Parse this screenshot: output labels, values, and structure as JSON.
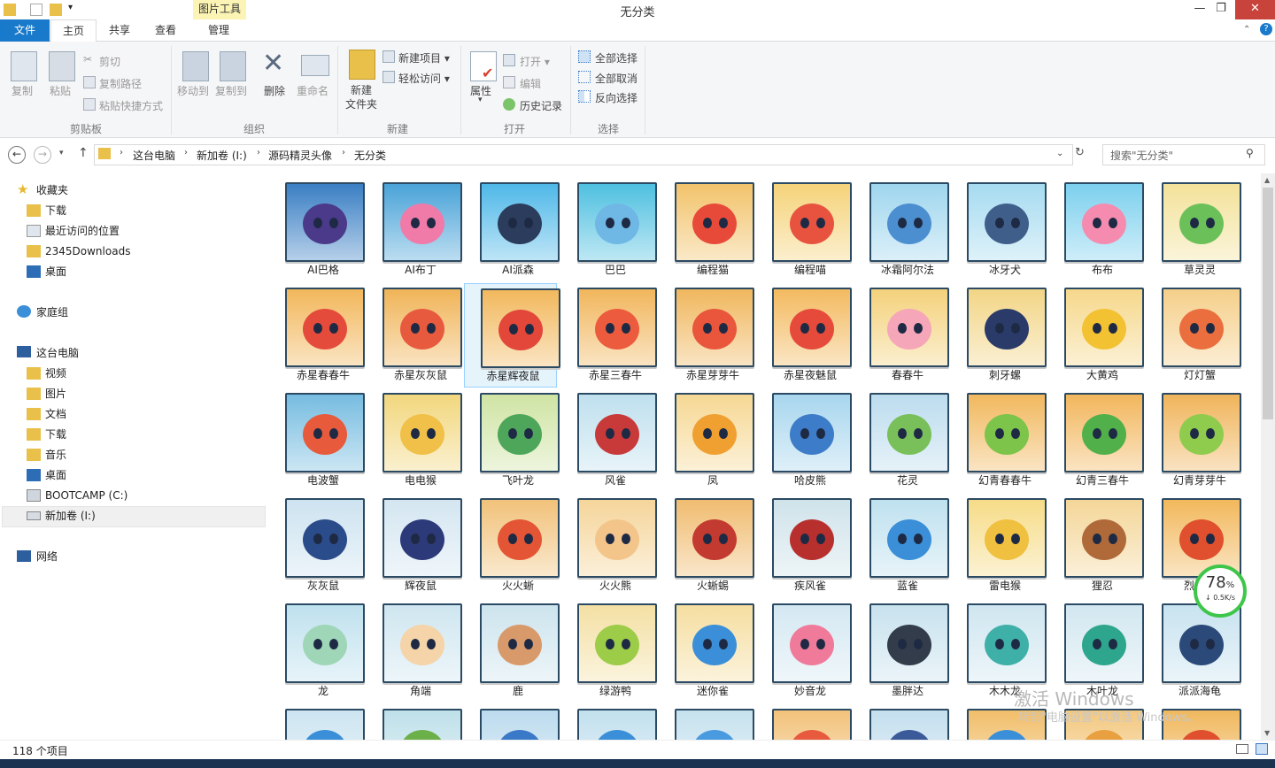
{
  "window": {
    "title": "无分类",
    "context_tab": "图片工具",
    "controls": {
      "minimize": "—",
      "maximize": "❐",
      "close": "✕"
    }
  },
  "tabs": [
    {
      "label": "文件"
    },
    {
      "label": "主页"
    },
    {
      "label": "共享"
    },
    {
      "label": "查看"
    },
    {
      "label": "管理"
    }
  ],
  "ribbon": {
    "clipboard": {
      "group": "剪贴板",
      "copy": "复制",
      "paste": "粘贴",
      "cut": "剪切",
      "copy_path": "复制路径",
      "paste_shortcut": "粘贴快捷方式"
    },
    "organize": {
      "group": "组织",
      "move_to": "移动到",
      "copy_to": "复制到",
      "delete": "删除",
      "rename": "重命名"
    },
    "new": {
      "group": "新建",
      "new_folder": "新建\n文件夹",
      "new_item": "新建项目 ▾",
      "easy_access": "轻松访问 ▾"
    },
    "open": {
      "group": "打开",
      "properties": "属性",
      "open": "打开 ▾",
      "edit": "编辑",
      "history": "历史记录"
    },
    "select": {
      "group": "选择",
      "select_all": "全部选择",
      "select_none": "全部取消",
      "invert": "反向选择"
    }
  },
  "address": {
    "crumbs": [
      "这台电脑",
      "新加卷 (I:)",
      "源码精灵头像",
      "无分类"
    ],
    "search_placeholder": "搜索\"无分类\""
  },
  "nav": {
    "favorites": "收藏夹",
    "fav_items": [
      "下载",
      "最近访问的位置",
      "2345Downloads",
      "桌面"
    ],
    "homegroup": "家庭组",
    "thispc": "这台电脑",
    "pc_items": [
      "视频",
      "图片",
      "文档",
      "下载",
      "音乐",
      "桌面",
      "BOOTCAMP (C:)",
      "新加卷 (I:)"
    ],
    "network": "网络"
  },
  "files": [
    {
      "name": "AI巴格",
      "bg": "#3a7fc4",
      "face": "#4b3a8a"
    },
    {
      "name": "AI布丁",
      "bg": "#4aa3d8",
      "face": "#f07aa8"
    },
    {
      "name": "AI派森",
      "bg": "#4fb8e8",
      "face": "#2b3c5c"
    },
    {
      "name": "巴巴",
      "bg": "#4fc0e0",
      "face": "#6fb8e6"
    },
    {
      "name": "编程猫",
      "bg": "#f2c36b",
      "face": "#e84a3a"
    },
    {
      "name": "编程喵",
      "bg": "#f5d37a",
      "face": "#e8533f"
    },
    {
      "name": "冰霜阿尔法",
      "bg": "#9fd6ee",
      "face": "#4c8fd0"
    },
    {
      "name": "冰牙犬",
      "bg": "#a6dbf0",
      "face": "#3f5f8a"
    },
    {
      "name": "布布",
      "bg": "#7cd0ee",
      "face": "#f58cb0"
    },
    {
      "name": "草灵灵",
      "bg": "#f3e29a",
      "face": "#6cc05a"
    },
    {
      "name": "赤星春春牛",
      "bg": "#f2b75b",
      "face": "#e54b3b"
    },
    {
      "name": "赤星灰灰鼠",
      "bg": "#f0b458",
      "face": "#e85a3e"
    },
    {
      "name": "赤星辉夜鼠",
      "bg": "#f2b85d",
      "face": "#e2473a"
    },
    {
      "name": "赤星三春牛",
      "bg": "#f1b65c",
      "face": "#ec5b3d"
    },
    {
      "name": "赤星芽芽牛",
      "bg": "#f0b75e",
      "face": "#e9563c"
    },
    {
      "name": "赤星夜魅鼠",
      "bg": "#f3ba60",
      "face": "#e64a3b"
    },
    {
      "name": "春春牛",
      "bg": "#f4d27c",
      "face": "#f5a6b8"
    },
    {
      "name": "刺牙螺",
      "bg": "#f2d586",
      "face": "#2a3b6a"
    },
    {
      "name": "大黄鸡",
      "bg": "#f6d88c",
      "face": "#f2c233"
    },
    {
      "name": "灯灯蟹",
      "bg": "#f5cf8a",
      "face": "#ea6e3e"
    },
    {
      "name": "电波蟹",
      "bg": "#76bce0",
      "face": "#e85a3c"
    },
    {
      "name": "电电猴",
      "bg": "#f2d77e",
      "face": "#f0c048"
    },
    {
      "name": "飞叶龙",
      "bg": "#cfe4a4",
      "face": "#4da65a"
    },
    {
      "name": "风雀",
      "bg": "#bfe0ee",
      "face": "#c83a3a"
    },
    {
      "name": "凤",
      "bg": "#f6d894",
      "face": "#f0a030"
    },
    {
      "name": "哈皮熊",
      "bg": "#a8d6ee",
      "face": "#3d7cc8"
    },
    {
      "name": "花灵",
      "bg": "#bcdcee",
      "face": "#7ac05a"
    },
    {
      "name": "幻青春春牛",
      "bg": "#f1b85e",
      "face": "#7cc44a"
    },
    {
      "name": "幻青三春牛",
      "bg": "#f2b65c",
      "face": "#52b04a"
    },
    {
      "name": "幻青芽芽牛",
      "bg": "#f0b45b",
      "face": "#8fcc4e"
    },
    {
      "name": "灰灰鼠",
      "bg": "#cde3f0",
      "face": "#2b4c8a"
    },
    {
      "name": "辉夜鼠",
      "bg": "#d4e6f1",
      "face": "#2c3a7a"
    },
    {
      "name": "火火蜥",
      "bg": "#f1c27a",
      "face": "#e45536"
    },
    {
      "name": "火火熊",
      "bg": "#f5d59a",
      "face": "#f3c58a"
    },
    {
      "name": "火蜥蜴",
      "bg": "#f0bc70",
      "face": "#c33a30"
    },
    {
      "name": "疾风雀",
      "bg": "#cfe3ea",
      "face": "#b8302e"
    },
    {
      "name": "蓝雀",
      "bg": "#bfe1ef",
      "face": "#3a8fd8"
    },
    {
      "name": "雷电猴",
      "bg": "#f6dc88",
      "face": "#f0c040"
    },
    {
      "name": "狸忍",
      "bg": "#f4d698",
      "face": "#b06a3a"
    },
    {
      "name": "烈焰龙",
      "bg": "#f2b85c",
      "face": "#e0502e"
    },
    {
      "name": "龙",
      "bg": "#bfe1ee",
      "face": "#9fd6b8"
    },
    {
      "name": "角端",
      "bg": "#cfe6f0",
      "face": "#f4d4a8"
    },
    {
      "name": "鹿",
      "bg": "#cde4ee",
      "face": "#d89a6a"
    },
    {
      "name": "绿游鸭",
      "bg": "#f4e0a4",
      "face": "#9ccc48"
    },
    {
      "name": "迷你雀",
      "bg": "#f5dea0",
      "face": "#3a8fd8"
    },
    {
      "name": "妙音龙",
      "bg": "#d4e8f2",
      "face": "#f07a9a"
    },
    {
      "name": "墨胖达",
      "bg": "#c8e2ee",
      "face": "#333c4a"
    },
    {
      "name": "木木龙",
      "bg": "#cfe6f0",
      "face": "#3fb0a8"
    },
    {
      "name": "木叶龙",
      "bg": "#d2e7f0",
      "face": "#2ea68e"
    },
    {
      "name": "派派海龟",
      "bg": "#c8e3f0",
      "face": "#2b4a7a"
    },
    {
      "name": "",
      "bg": "#cde5f1",
      "face": "#3a8fd8"
    },
    {
      "name": "",
      "bg": "#bfe0ea",
      "face": "#6cb04a"
    },
    {
      "name": "",
      "bg": "#bcdbee",
      "face": "#3a78c8"
    },
    {
      "name": "",
      "bg": "#c2e0ee",
      "face": "#3a8fd8"
    },
    {
      "name": "",
      "bg": "#c6e2ee",
      "face": "#4a9ae0"
    },
    {
      "name": "",
      "bg": "#f2c27a",
      "face": "#e85a3e"
    },
    {
      "name": "",
      "bg": "#c4dfee",
      "face": "#3a5a9a"
    },
    {
      "name": "",
      "bg": "#f1be6a",
      "face": "#3a8fd8"
    },
    {
      "name": "",
      "bg": "#f3c880",
      "face": "#e8a040"
    },
    {
      "name": "",
      "bg": "#f0b85e",
      "face": "#e0502e"
    }
  ],
  "status": {
    "count": "118 个项目"
  },
  "speed": {
    "percent": "78",
    "percent_unit": "%",
    "rate": "↓ 0.5K/s"
  },
  "watermark": {
    "line1": "激活 Windows",
    "line2": "转到\"电脑设置\"以激活 Windows。"
  },
  "colors": {
    "file_tab": "#1979ca",
    "selection": "#e5f3fb",
    "context_tab": "#fbf4b4",
    "speed_ring": "#3ec64a"
  }
}
